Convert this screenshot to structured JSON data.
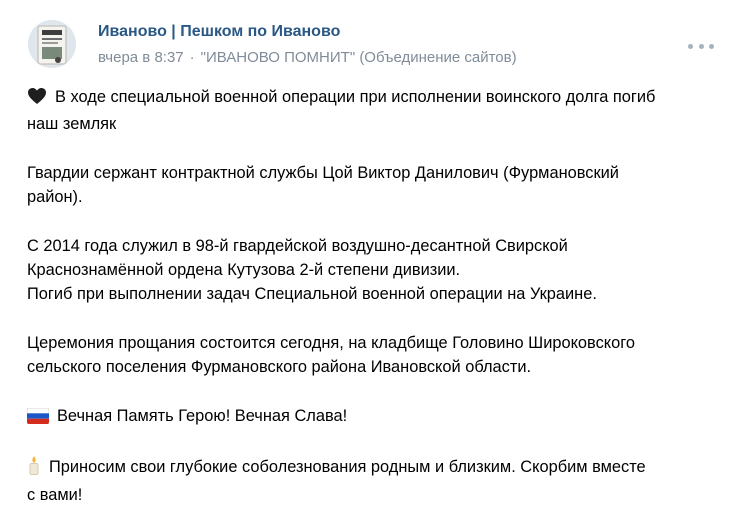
{
  "header": {
    "group_name": "Иваново | Пешком по Иваново",
    "time": "вчера в 8:37",
    "separator": "·",
    "source": "\"ИВАНОВО ПОМНИТ\" (Объединение сайтов)"
  },
  "icons": {
    "avatar": "group-avatar",
    "heart": "black-heart-icon",
    "flag": "russian-flag-icon",
    "candle": "candle-icon",
    "more": "more-options-icon"
  },
  "colors": {
    "link": "#2a5885",
    "meta": "#818c99"
  },
  "post": {
    "p1_l1": "В ходе специальной военной операции при исполнении воинского долга погиб",
    "p1_l2": "наш земляк",
    "p2_l1": "Гвардии сержант контрактной службы Цой Виктор Данилович (Фурмановский",
    "p2_l2": "район).",
    "p3_l1": "С 2014 года служил в 98-й гвардейской воздушно-десантной Свирской",
    "p3_l2": "Краснознамённой ордена Кутузова 2-й степени дивизии.",
    "p3_l3": "Погиб при выполнении задач Специальной военной операции на Украине.",
    "p4_l1": "Церемония прощания состоится сегодня, на кладбище Головино Широковского",
    "p4_l2": "сельского поселения Фурмановского района Ивановской области.",
    "p5": "Вечная Память Герою! Вечная Слава!",
    "p6_l1": "Приносим свои глубокие соболезнования родным и близким. Скорбим вместе",
    "p6_l2": "с вами!"
  }
}
